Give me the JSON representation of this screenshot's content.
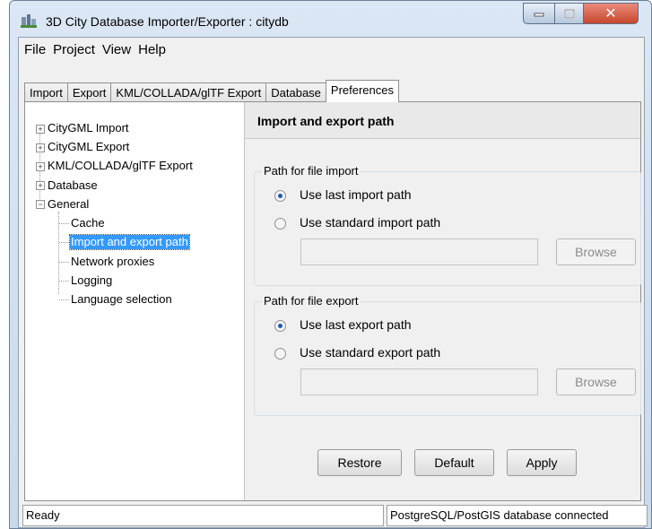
{
  "window": {
    "title": "3D City Database Importer/Exporter : citydb"
  },
  "menu": [
    "File",
    "Project",
    "View",
    "Help"
  ],
  "tabs": [
    "Import",
    "Export",
    "KML/COLLADA/glTF Export",
    "Database",
    "Preferences"
  ],
  "tree": {
    "top": [
      "CityGML Import",
      "CityGML Export",
      "KML/COLLADA/glTF Export",
      "Database",
      "General"
    ],
    "children": [
      "Cache",
      "Import and export path",
      "Network proxies",
      "Logging",
      "Language selection"
    ]
  },
  "panel": {
    "title": "Import and export path",
    "import_group": {
      "title": "Path for file import",
      "option1": "Use last import path",
      "option2": "Use standard import path",
      "browse": "Browse",
      "path_value": ""
    },
    "export_group": {
      "title": "Path for file export",
      "option1": "Use last export path",
      "option2": "Use standard export path",
      "browse": "Browse",
      "path_value": ""
    },
    "buttons": {
      "restore": "Restore",
      "default": "Default",
      "apply": "Apply"
    }
  },
  "status": {
    "left": "Ready",
    "right": "PostgreSQL/PostGIS database connected"
  },
  "colors": {
    "selection": "#3399ff",
    "radio_dot": "#1d5ab0",
    "close_button": "#c7462c"
  },
  "icons": [
    "app-icon",
    "minimize-icon",
    "maximize-icon",
    "close-icon",
    "expand-icon",
    "collapse-icon"
  ]
}
